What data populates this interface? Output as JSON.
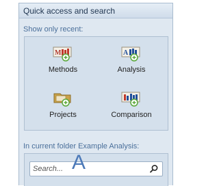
{
  "panel": {
    "title": "Quick access and search"
  },
  "recent": {
    "label": "Show only recent:",
    "items": [
      {
        "label": "Methods",
        "icon": "methods-icon"
      },
      {
        "label": "Analysis",
        "icon": "analysis-icon"
      },
      {
        "label": "Projects",
        "icon": "projects-icon"
      },
      {
        "label": "Comparison",
        "icon": "comparison-icon"
      }
    ]
  },
  "folder_search": {
    "label": "In current folder Example Analysis:",
    "placeholder": "Search...",
    "cursor_text": "A"
  },
  "colors": {
    "panel_bg": "#dfe8f1",
    "section_label": "#4a6f9a",
    "accent_green": "#5aa83a",
    "bar_red": "#c0392b",
    "bar_blue": "#1f4e9a"
  }
}
